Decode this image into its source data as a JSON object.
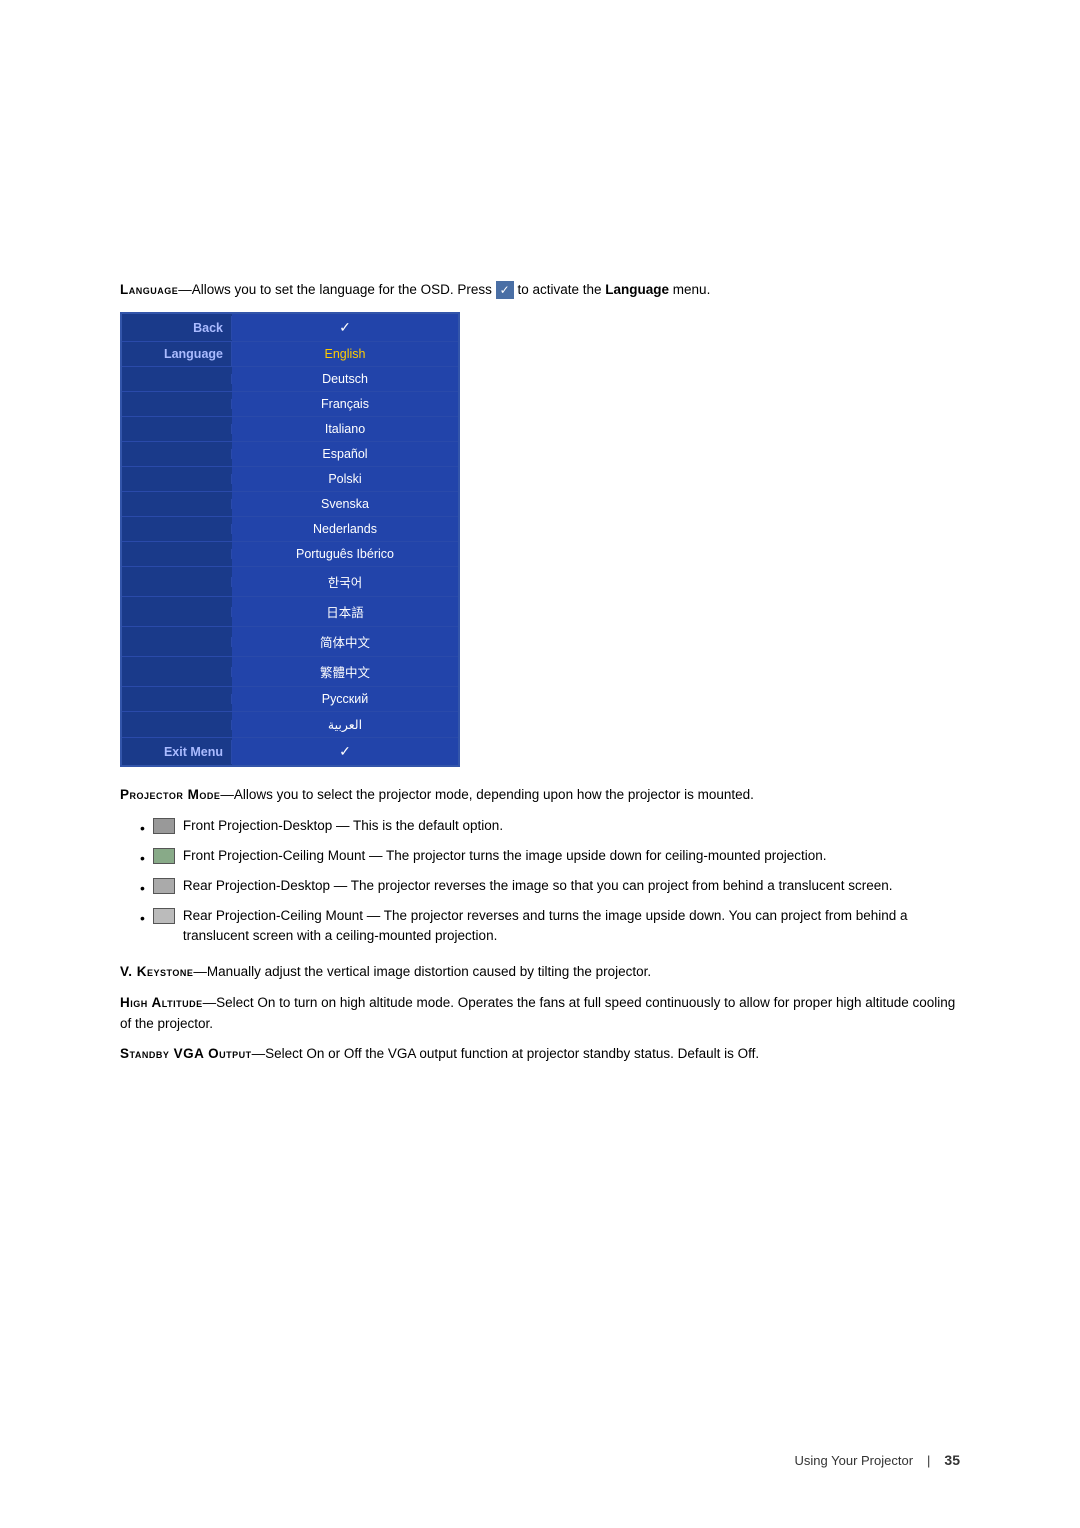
{
  "intro": {
    "label": "Language",
    "description_before": "—Allows you to set the language for the OSD. Press",
    "description_after": "to activate the",
    "description_link": "Language",
    "description_end": "menu."
  },
  "menu": {
    "back_label": "Back",
    "back_value": "✓",
    "language_label": "Language",
    "language_selected": "English",
    "languages": [
      "English",
      "Deutsch",
      "Français",
      "Italiano",
      "Español",
      "Polski",
      "Svenska",
      "Nederlands",
      "Português Ibérico",
      "한국어",
      "日本語",
      "简体中文",
      "繁體中文",
      "Русский",
      "العربية"
    ],
    "exit_label": "Exit Menu",
    "exit_value": "✓"
  },
  "projector_mode": {
    "label": "Projector Mode",
    "description": "—Allows you to select the projector mode, depending upon how the projector is mounted.",
    "bullets": [
      {
        "icon_type": "front-desk",
        "text": "Front Projection-Desktop — This is the default option."
      },
      {
        "icon_type": "front-ceil",
        "text": "Front Projection-Ceiling Mount — The projector turns the image upside down for ceiling-mounted projection."
      },
      {
        "icon_type": "rear-desk",
        "text": "Rear Projection-Desktop — The projector reverses the image so that you can project from behind a translucent screen."
      },
      {
        "icon_type": "rear-ceil",
        "text": "Rear Projection-Ceiling Mount — The projector reverses and turns the image upside down. You can project from behind a translucent screen with a ceiling-mounted projection."
      }
    ]
  },
  "v_keystone": {
    "label": "V. Keystone",
    "description": "—Manually adjust the vertical image distortion caused by tilting the projector."
  },
  "high_altitude": {
    "label": "High Altitude",
    "description": "—Select On to turn on high altitude mode. Operates the fans at full speed continuously to allow for proper high altitude cooling of the projector."
  },
  "standby_vga": {
    "label": "Standby VGA Output",
    "description": "—Select On or Off the VGA output function at projector standby status. Default is Off."
  },
  "footer": {
    "section_label": "Using Your Projector",
    "separator": "|",
    "page_number": "35"
  }
}
